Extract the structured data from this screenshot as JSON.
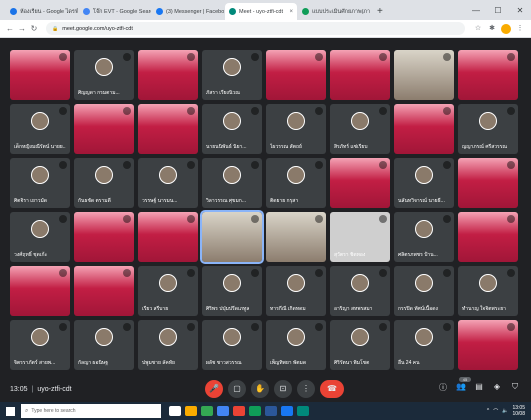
{
  "browser": {
    "tabs": [
      {
        "title": "ห้องเรียน - Google ไดรฟ์",
        "color": "#1a73e8"
      },
      {
        "title": "โจ๊ก EVT - Google Search",
        "color": "#4285f4"
      },
      {
        "title": "(3) Messenger | Facebook",
        "color": "#1877f2"
      },
      {
        "title": "Meet - uyo-ztfi-cdt",
        "color": "#00897b",
        "active": true
      },
      {
        "title": "แบบประเมินศักยภาพ(ภาษา2)(ภ)",
        "color": "#0f9d58"
      }
    ],
    "new_tab": "+",
    "url": "meet.google.com/uyo-ztfi-cdt"
  },
  "meeting": {
    "time": "13:05",
    "separator": "|",
    "code": "uyo-ztfi-cdt",
    "participant_count": "45"
  },
  "participants": [
    {
      "name": "",
      "style": "red"
    },
    {
      "name": "ศิญญดา กรมตาม...",
      "style": "dark"
    },
    {
      "name": "",
      "style": "red"
    },
    {
      "name": "ภัสรา เรียงนิวณ",
      "style": "dark"
    },
    {
      "name": "",
      "style": "red"
    },
    {
      "name": "",
      "style": "red"
    },
    {
      "name": "",
      "style": "photo"
    },
    {
      "name": "",
      "style": "red"
    },
    {
      "name": "เด็กหญิงมณีรัตน์ นายย...",
      "style": "dark"
    },
    {
      "name": "",
      "style": "red"
    },
    {
      "name": "",
      "style": "red"
    },
    {
      "name": "นายนนิพันธ์ นิยา...",
      "style": "dark"
    },
    {
      "name": "ไผวรรณ สัตถย์",
      "style": "dark"
    },
    {
      "name": "สิรภัทร์ แซ่เรียบ",
      "style": "dark"
    },
    {
      "name": "",
      "style": "red"
    },
    {
      "name": "ญญาภรณ์ ศรีสวรรณ",
      "style": "dark"
    },
    {
      "name": "ศิตจิรา เยาวมัด",
      "style": "dark"
    },
    {
      "name": "กันธชัด ตรามดี",
      "style": "dark"
    },
    {
      "name": "วรรษฐ์ นารมน...",
      "style": "dark"
    },
    {
      "name": "วิลาวรรณ ศุขมก...",
      "style": "dark"
    },
    {
      "name": "ติดยาย กรุสา",
      "style": "dark"
    },
    {
      "name": "",
      "style": "red"
    },
    {
      "name": "นลันทวิจารณ์ นายธี...",
      "style": "dark"
    },
    {
      "name": "",
      "style": "red"
    },
    {
      "name": "วงศ์ฤทธิ์ ชุดเก้ะ",
      "style": "dark"
    },
    {
      "name": "",
      "style": "red"
    },
    {
      "name": "",
      "style": "red"
    },
    {
      "name": "",
      "style": "photo",
      "active": true
    },
    {
      "name": "",
      "style": "photo"
    },
    {
      "name": "สุวัตรา ชิดทอง",
      "style": "blank"
    },
    {
      "name": "ศลิตรภพชร ป้าน...",
      "style": "dark"
    },
    {
      "name": "",
      "style": "red"
    },
    {
      "name": "",
      "style": "red"
    },
    {
      "name": "",
      "style": "red"
    },
    {
      "name": "เรียว สรีบาย",
      "style": "dark"
    },
    {
      "name": "ศิริพร ปปุ่มปรีดเภทูล",
      "style": "dark"
    },
    {
      "name": "ทารกีณี เกิดทดม",
      "style": "dark"
    },
    {
      "name": "อาริญา สหพรสมา",
      "style": "dark"
    },
    {
      "name": "กรรปิด ทัศน์เนื้อดง",
      "style": "dark"
    },
    {
      "name": "ทำนาญ ใจจิตพระยา",
      "style": "dark"
    },
    {
      "name": "จิตรราภัตร์ สายพ...",
      "style": "dark"
    },
    {
      "name": "กัลญา ผอนิษฐ",
      "style": "dark"
    },
    {
      "name": "ปพูมชาย ลัคทัย",
      "style": "dark"
    },
    {
      "name": "ผลัช ชาวสวรรณ",
      "style": "dark"
    },
    {
      "name": "เพ็ญทิพยา พัตมด",
      "style": "dark"
    },
    {
      "name": "ศิริรัตนา พิมโชต",
      "style": "dark"
    },
    {
      "name": "อื่น 24 คน",
      "style": "dark"
    },
    {
      "name": "",
      "style": "red"
    }
  ],
  "controls": {
    "mic": "mic-off-icon",
    "cam": "camera-icon",
    "hand": "hand-icon",
    "present": "present-icon",
    "more": "more-icon",
    "end": "end-call-icon"
  },
  "right_controls": [
    "info-icon",
    "people-icon",
    "chat-icon",
    "activities-icon",
    "shield-icon"
  ],
  "taskbar": {
    "search_placeholder": "Type here to search",
    "date_line_1": "13:05",
    "date_line_2": "10/08"
  },
  "colors": {
    "meet_bg": "#202124",
    "red_tile": "#c21e44",
    "end_call": "#ea4335"
  }
}
